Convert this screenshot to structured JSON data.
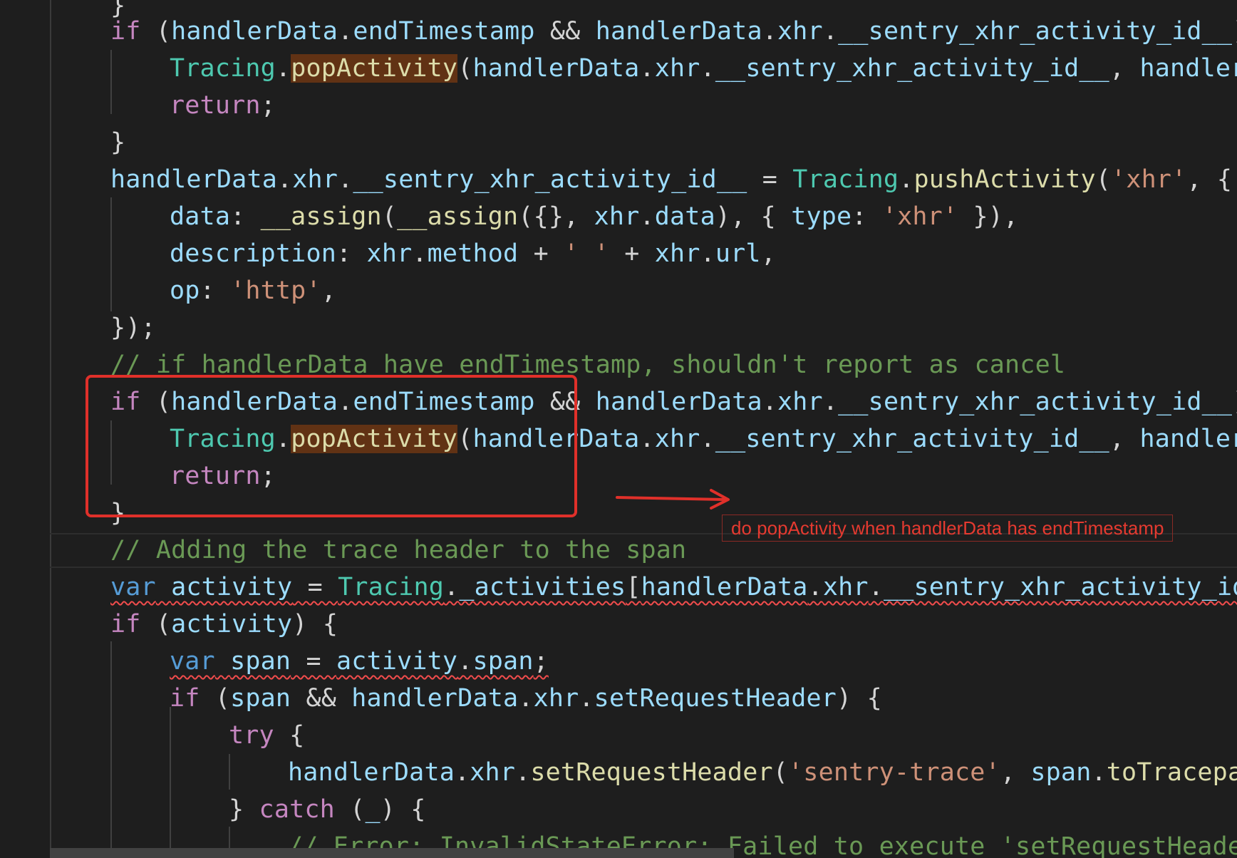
{
  "editor": {
    "lines": [
      {
        "id": "l00",
        "tokens": [
          {
            "t": "}",
            "c": "pl"
          }
        ]
      },
      {
        "id": "l01",
        "tokens": [
          {
            "t": "if",
            "c": "kw"
          },
          {
            "t": " (",
            "c": "pl"
          },
          {
            "t": "handlerData",
            "c": "vr"
          },
          {
            "t": ".",
            "c": "pl"
          },
          {
            "t": "endTimestamp",
            "c": "vr"
          },
          {
            "t": " && ",
            "c": "pl"
          },
          {
            "t": "handlerData",
            "c": "vr"
          },
          {
            "t": ".",
            "c": "pl"
          },
          {
            "t": "xhr",
            "c": "vr"
          },
          {
            "t": ".",
            "c": "pl"
          },
          {
            "t": "__sentry_xhr_activity_id__",
            "c": "vr"
          },
          {
            "t": ")",
            "c": "pl"
          }
        ]
      },
      {
        "id": "l02",
        "tokens": [
          {
            "t": "Tracing",
            "c": "ty"
          },
          {
            "t": ".",
            "c": "pl"
          },
          {
            "t": "popActivity",
            "c": "fn hl"
          },
          {
            "t": "(",
            "c": "pl"
          },
          {
            "t": "handlerData",
            "c": "vr"
          },
          {
            "t": ".",
            "c": "pl"
          },
          {
            "t": "xhr",
            "c": "vr"
          },
          {
            "t": ".",
            "c": "pl"
          },
          {
            "t": "__sentry_xhr_activity_id__",
            "c": "vr"
          },
          {
            "t": ", ",
            "c": "pl"
          },
          {
            "t": "handlerD",
            "c": "vr"
          }
        ]
      },
      {
        "id": "l03",
        "tokens": [
          {
            "t": "return",
            "c": "kw"
          },
          {
            "t": ";",
            "c": "pl"
          }
        ]
      },
      {
        "id": "l04",
        "tokens": [
          {
            "t": "}",
            "c": "pl"
          }
        ]
      },
      {
        "id": "l05",
        "tokens": [
          {
            "t": "handlerData",
            "c": "vr"
          },
          {
            "t": ".",
            "c": "pl"
          },
          {
            "t": "xhr",
            "c": "vr"
          },
          {
            "t": ".",
            "c": "pl"
          },
          {
            "t": "__sentry_xhr_activity_id__",
            "c": "vr"
          },
          {
            "t": " = ",
            "c": "pl"
          },
          {
            "t": "Tracing",
            "c": "ty"
          },
          {
            "t": ".",
            "c": "pl"
          },
          {
            "t": "pushActivity",
            "c": "fn"
          },
          {
            "t": "(",
            "c": "pl"
          },
          {
            "t": "'xhr'",
            "c": "str"
          },
          {
            "t": ", {",
            "c": "pl"
          }
        ]
      },
      {
        "id": "l06",
        "tokens": [
          {
            "t": "data",
            "c": "vr"
          },
          {
            "t": ": ",
            "c": "pl"
          },
          {
            "t": "__assign",
            "c": "fn"
          },
          {
            "t": "(",
            "c": "pl"
          },
          {
            "t": "__assign",
            "c": "fn"
          },
          {
            "t": "({}, ",
            "c": "pl"
          },
          {
            "t": "xhr",
            "c": "vr"
          },
          {
            "t": ".",
            "c": "pl"
          },
          {
            "t": "data",
            "c": "vr"
          },
          {
            "t": "), { ",
            "c": "pl"
          },
          {
            "t": "type",
            "c": "vr"
          },
          {
            "t": ": ",
            "c": "pl"
          },
          {
            "t": "'xhr'",
            "c": "str"
          },
          {
            "t": " }),",
            "c": "pl"
          }
        ]
      },
      {
        "id": "l07",
        "tokens": [
          {
            "t": "description",
            "c": "vr"
          },
          {
            "t": ": ",
            "c": "pl"
          },
          {
            "t": "xhr",
            "c": "vr"
          },
          {
            "t": ".",
            "c": "pl"
          },
          {
            "t": "method",
            "c": "vr"
          },
          {
            "t": " + ",
            "c": "pl"
          },
          {
            "t": "' '",
            "c": "str"
          },
          {
            "t": " + ",
            "c": "pl"
          },
          {
            "t": "xhr",
            "c": "vr"
          },
          {
            "t": ".",
            "c": "pl"
          },
          {
            "t": "url",
            "c": "vr"
          },
          {
            "t": ",",
            "c": "pl"
          }
        ]
      },
      {
        "id": "l08",
        "tokens": [
          {
            "t": "op",
            "c": "vr"
          },
          {
            "t": ": ",
            "c": "pl"
          },
          {
            "t": "'http'",
            "c": "str"
          },
          {
            "t": ",",
            "c": "pl"
          }
        ]
      },
      {
        "id": "l09",
        "tokens": [
          {
            "t": "});",
            "c": "pl"
          }
        ]
      },
      {
        "id": "l10",
        "tokens": [
          {
            "t": "// if handlerData have endTimestamp, shouldn't report as cancel",
            "c": "cm"
          }
        ]
      },
      {
        "id": "l11",
        "tokens": [
          {
            "t": "if",
            "c": "kw"
          },
          {
            "t": " (",
            "c": "pl"
          },
          {
            "t": "handlerData",
            "c": "vr"
          },
          {
            "t": ".",
            "c": "pl"
          },
          {
            "t": "endTimestamp",
            "c": "vr"
          },
          {
            "t": " && ",
            "c": "pl"
          },
          {
            "t": "handlerData",
            "c": "vr"
          },
          {
            "t": ".",
            "c": "pl"
          },
          {
            "t": "xhr",
            "c": "vr"
          },
          {
            "t": ".",
            "c": "pl"
          },
          {
            "t": "__sentry_xhr_activity_id__",
            "c": "vr"
          },
          {
            "t": ")",
            "c": "pl"
          }
        ]
      },
      {
        "id": "l12",
        "tokens": [
          {
            "t": "Tracing",
            "c": "ty"
          },
          {
            "t": ".",
            "c": "pl"
          },
          {
            "t": "popActivity",
            "c": "fn hl"
          },
          {
            "t": "(",
            "c": "pl"
          },
          {
            "t": "handlerData",
            "c": "vr"
          },
          {
            "t": ".",
            "c": "pl"
          },
          {
            "t": "xhr",
            "c": "vr"
          },
          {
            "t": ".",
            "c": "pl"
          },
          {
            "t": "__sentry_xhr_activity_id__",
            "c": "vr"
          },
          {
            "t": ", ",
            "c": "pl"
          },
          {
            "t": "handlerD",
            "c": "vr"
          }
        ]
      },
      {
        "id": "l13",
        "tokens": [
          {
            "t": "return",
            "c": "kw"
          },
          {
            "t": ";",
            "c": "pl"
          }
        ]
      },
      {
        "id": "l14",
        "tokens": [
          {
            "t": "}",
            "c": "pl"
          }
        ]
      },
      {
        "id": "l15",
        "tokens": [
          {
            "t": "// Adding the trace header to the span",
            "c": "cm"
          }
        ]
      },
      {
        "id": "l16",
        "tokens": [
          {
            "t": "var",
            "c": "st squig"
          },
          {
            "t": " ",
            "c": "pl squig"
          },
          {
            "t": "activity",
            "c": "vr squig"
          },
          {
            "t": " = ",
            "c": "pl squig"
          },
          {
            "t": "Tracing",
            "c": "ty squig"
          },
          {
            "t": ".",
            "c": "pl squig"
          },
          {
            "t": "_activities",
            "c": "vr squig"
          },
          {
            "t": "[",
            "c": "pl squig"
          },
          {
            "t": "handlerData",
            "c": "vr squig"
          },
          {
            "t": ".",
            "c": "pl squig"
          },
          {
            "t": "xhr",
            "c": "vr squig"
          },
          {
            "t": ".",
            "c": "pl squig"
          },
          {
            "t": "__sentry_xhr_activity_id_",
            "c": "vr squig"
          }
        ]
      },
      {
        "id": "l17",
        "tokens": [
          {
            "t": "if",
            "c": "kw"
          },
          {
            "t": " (",
            "c": "pl"
          },
          {
            "t": "activity",
            "c": "vr"
          },
          {
            "t": ") {",
            "c": "pl"
          }
        ]
      },
      {
        "id": "l18",
        "tokens": [
          {
            "t": "var",
            "c": "st squig"
          },
          {
            "t": " ",
            "c": "pl squig"
          },
          {
            "t": "span",
            "c": "vr squig"
          },
          {
            "t": " = ",
            "c": "pl squig"
          },
          {
            "t": "activity",
            "c": "vr squig"
          },
          {
            "t": ".",
            "c": "pl squig"
          },
          {
            "t": "span",
            "c": "vr squig"
          },
          {
            "t": ";",
            "c": "pl squig"
          }
        ]
      },
      {
        "id": "l19",
        "tokens": [
          {
            "t": "if",
            "c": "kw"
          },
          {
            "t": " (",
            "c": "pl"
          },
          {
            "t": "span",
            "c": "vr"
          },
          {
            "t": " && ",
            "c": "pl"
          },
          {
            "t": "handlerData",
            "c": "vr"
          },
          {
            "t": ".",
            "c": "pl"
          },
          {
            "t": "xhr",
            "c": "vr"
          },
          {
            "t": ".",
            "c": "pl"
          },
          {
            "t": "setRequestHeader",
            "c": "vr"
          },
          {
            "t": ") {",
            "c": "pl"
          }
        ]
      },
      {
        "id": "l20",
        "tokens": [
          {
            "t": "try",
            "c": "kw"
          },
          {
            "t": " {",
            "c": "pl"
          }
        ]
      },
      {
        "id": "l21",
        "tokens": [
          {
            "t": "handlerData",
            "c": "vr"
          },
          {
            "t": ".",
            "c": "pl"
          },
          {
            "t": "xhr",
            "c": "vr"
          },
          {
            "t": ".",
            "c": "pl"
          },
          {
            "t": "setRequestHeader",
            "c": "fn"
          },
          {
            "t": "(",
            "c": "pl"
          },
          {
            "t": "'sentry-trace'",
            "c": "str"
          },
          {
            "t": ", ",
            "c": "pl"
          },
          {
            "t": "span",
            "c": "vr"
          },
          {
            "t": ".",
            "c": "pl"
          },
          {
            "t": "toTracepar",
            "c": "fn"
          }
        ]
      },
      {
        "id": "l22",
        "tokens": [
          {
            "t": "} ",
            "c": "pl"
          },
          {
            "t": "catch",
            "c": "kw"
          },
          {
            "t": " (",
            "c": "pl"
          },
          {
            "t": "_",
            "c": "vr"
          },
          {
            "t": ") {",
            "c": "pl"
          }
        ]
      },
      {
        "id": "l23",
        "tokens": [
          {
            "t": "// Error: InvalidStateError: Failed to execute 'setRequestHeader",
            "c": "cm"
          }
        ]
      }
    ]
  },
  "annotation": {
    "label": "do popActivity when handlerData has endTimestamp",
    "color": "#e0302a"
  }
}
